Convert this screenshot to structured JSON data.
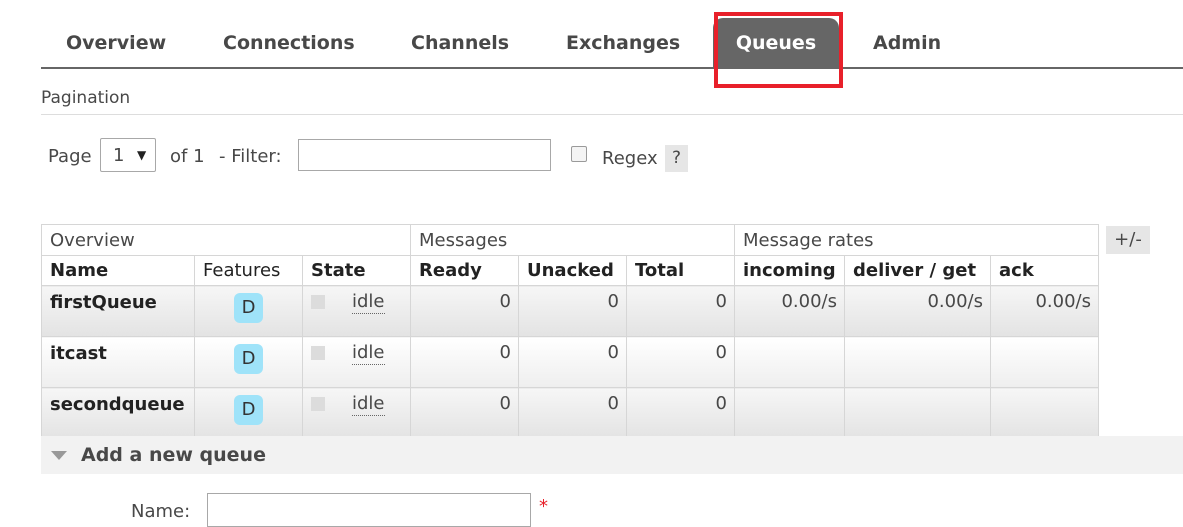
{
  "tabs": [
    {
      "label": "Overview",
      "active": false
    },
    {
      "label": "Connections",
      "active": false
    },
    {
      "label": "Channels",
      "active": false
    },
    {
      "label": "Exchanges",
      "active": false
    },
    {
      "label": "Queues",
      "active": true
    },
    {
      "label": "Admin",
      "active": false
    }
  ],
  "pagination": {
    "heading": "Pagination",
    "page_label": "Page",
    "page_value": "1",
    "of_label": "of 1",
    "filter_label": "- Filter:",
    "filter_value": "",
    "regex_label": "Regex",
    "regex_checked": false,
    "help_label": "?"
  },
  "table": {
    "groups": [
      "Overview",
      "Messages",
      "Message rates"
    ],
    "columns": [
      "Name",
      "Features",
      "State",
      "Ready",
      "Unacked",
      "Total",
      "incoming",
      "deliver / get",
      "ack"
    ],
    "rows": [
      {
        "name": "firstQueue",
        "feature": "D",
        "state": "idle",
        "ready": "0",
        "unacked": "0",
        "total": "0",
        "incoming": "0.00/s",
        "deliver_get": "0.00/s",
        "ack": "0.00/s"
      },
      {
        "name": "itcast",
        "feature": "D",
        "state": "idle",
        "ready": "0",
        "unacked": "0",
        "total": "0",
        "incoming": "",
        "deliver_get": "",
        "ack": ""
      },
      {
        "name": "secondqueue",
        "feature": "D",
        "state": "idle",
        "ready": "0",
        "unacked": "0",
        "total": "0",
        "incoming": "",
        "deliver_get": "",
        "ack": ""
      }
    ],
    "toggle_label": "+/-"
  },
  "add_queue": {
    "title": "Add a new queue",
    "name_label": "Name:",
    "name_value": "",
    "required_mark": "*"
  },
  "colors": {
    "active_tab_bg": "#666666",
    "highlight_border": "#e8202a",
    "feature_badge": "#9fe3f9"
  }
}
